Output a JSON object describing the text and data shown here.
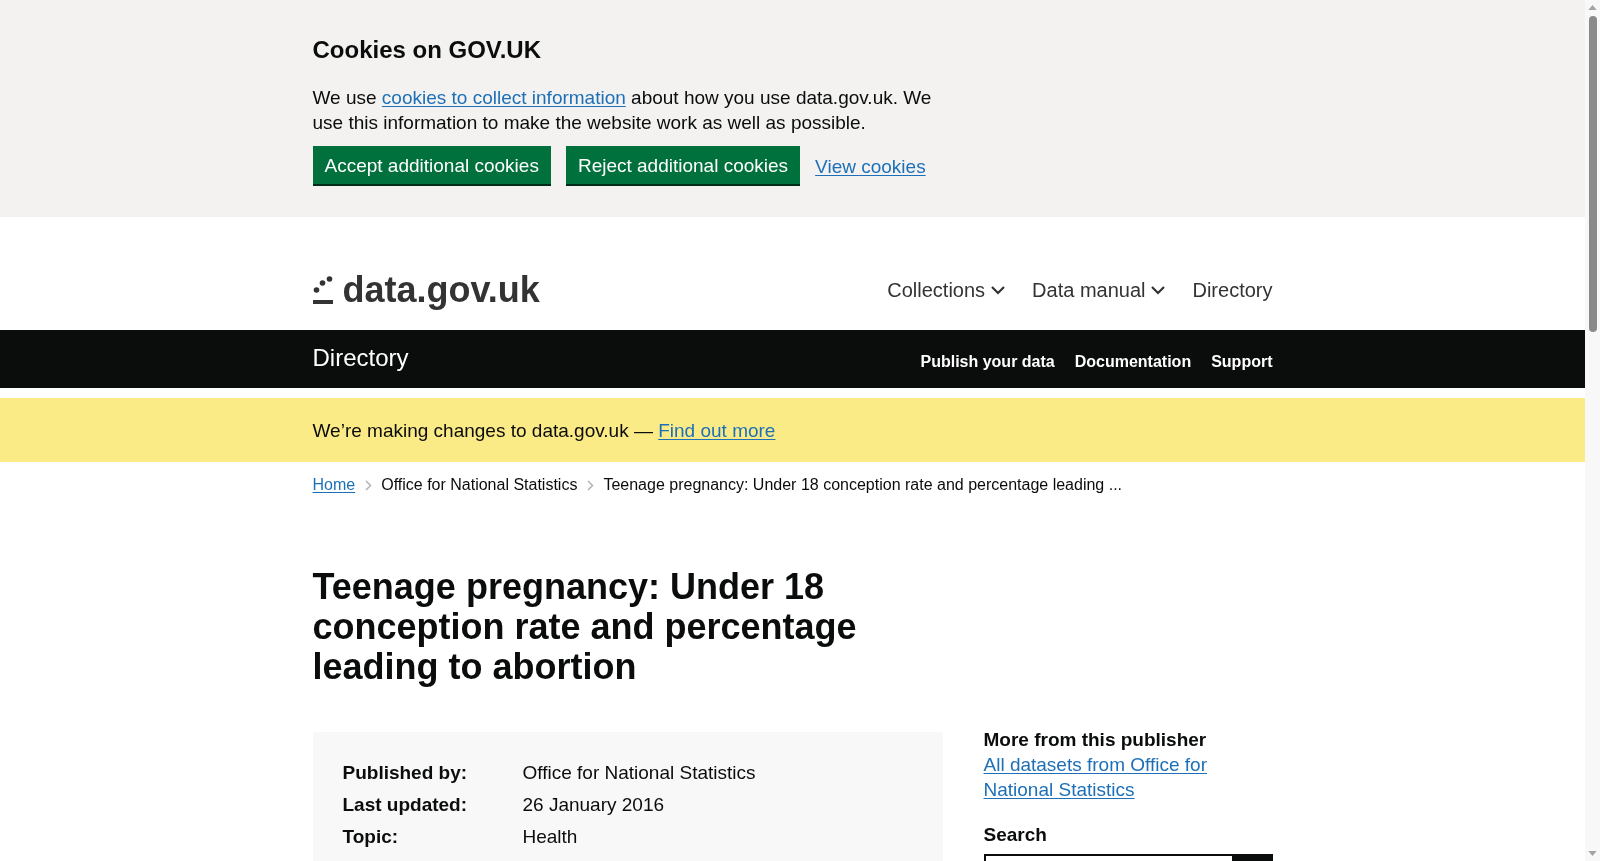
{
  "cookie_banner": {
    "title": "Cookies on GOV.UK",
    "text_before": "We use ",
    "link": "cookies to collect information",
    "text_after": " about how you use data.gov.uk. We use this information to make the website work as well as possible.",
    "buttons": [
      "Accept additional cookies",
      "Reject additional cookies"
    ],
    "view_link": "View cookies"
  },
  "header": {
    "logo": "data.gov.uk",
    "nav": [
      {
        "label": "Collections",
        "dropdown": true
      },
      {
        "label": "Data manual",
        "dropdown": true
      },
      {
        "label": "Directory",
        "dropdown": false
      }
    ]
  },
  "service_bar": {
    "title": "Directory",
    "links": [
      "Publish your data",
      "Documentation",
      "Support"
    ]
  },
  "notice": {
    "text": "We’re making changes to data.gov.uk — ",
    "link": "Find out more"
  },
  "breadcrumbs": [
    {
      "label": "Home",
      "link": true
    },
    {
      "label": "Office for National Statistics",
      "link": false
    },
    {
      "label": "Teenage pregnancy: Under 18 conception rate and percentage leading ...",
      "link": false
    }
  ],
  "title": "Teenage pregnancy: Under 18 conception rate and percentage leading to abortion",
  "summary": [
    {
      "label": "Published by:",
      "value": "Office for National Statistics"
    },
    {
      "label": "Last updated:",
      "value": "26 January 2016"
    },
    {
      "label": "Topic:",
      "value": "Health"
    }
  ],
  "sidebar": {
    "heading": "More from this publisher",
    "link": "All datasets from Office for National Statistics",
    "search_heading": "Search"
  }
}
